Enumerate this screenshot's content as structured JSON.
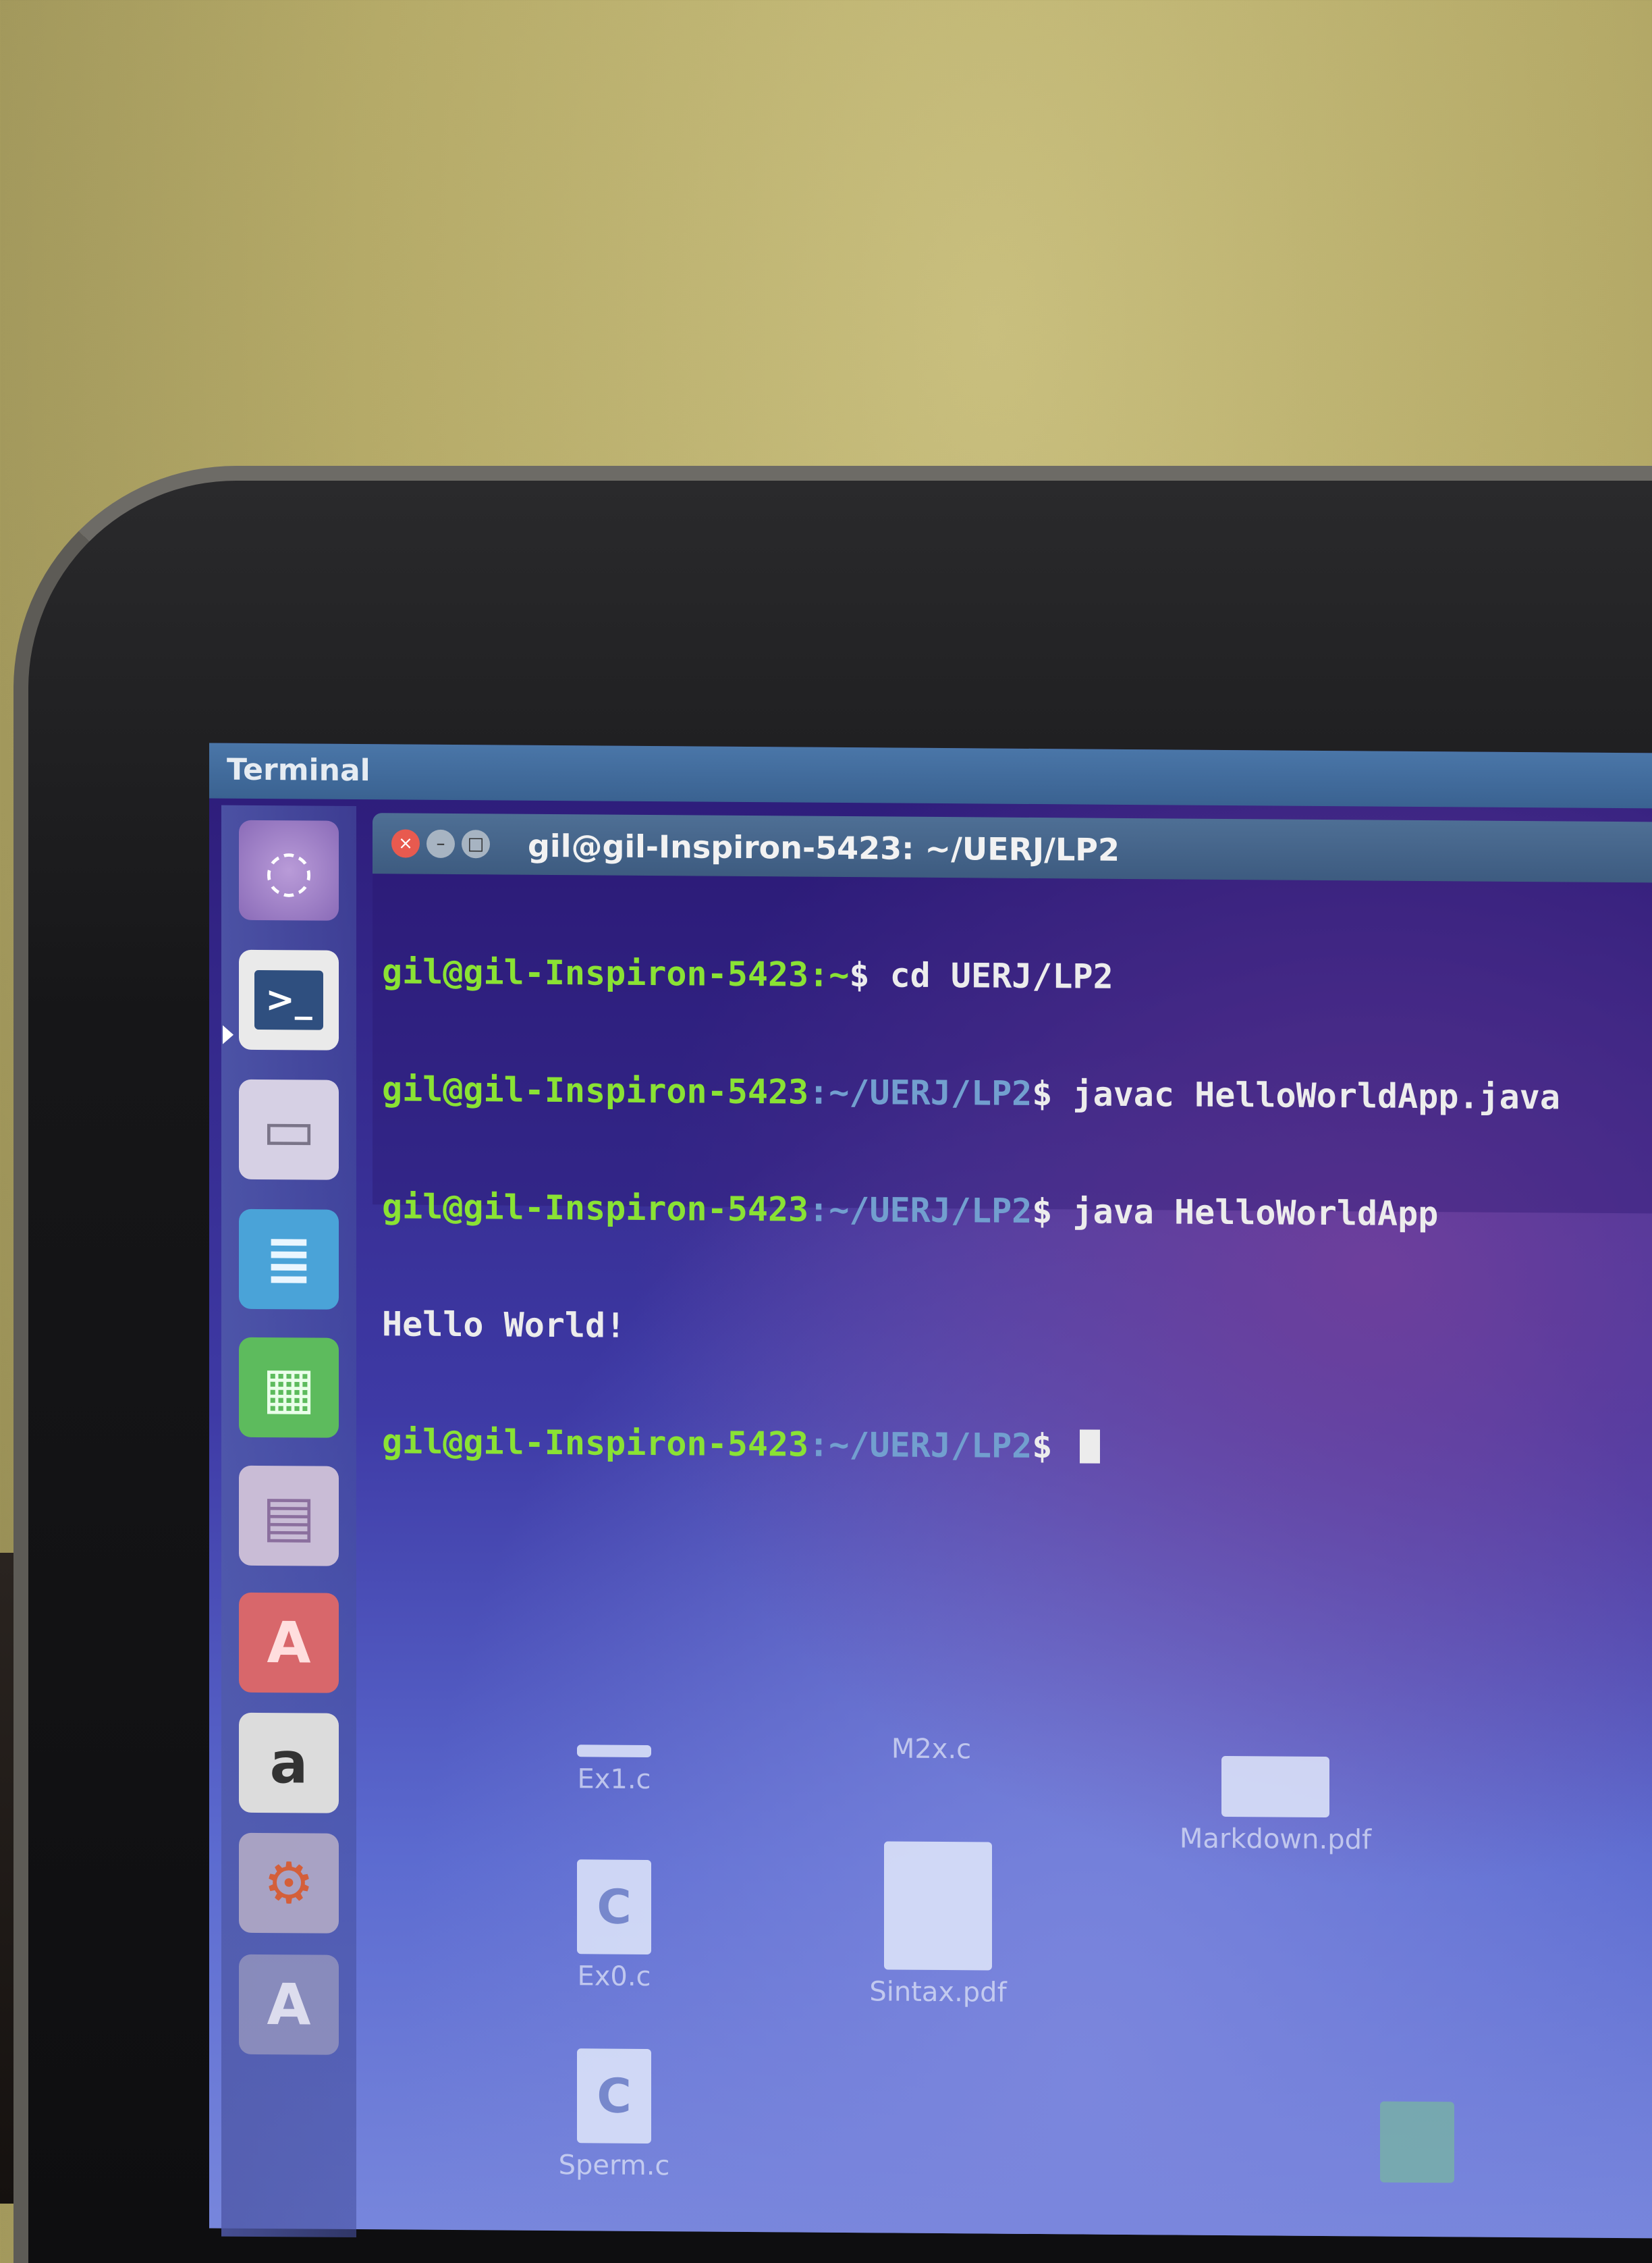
{
  "panel": {
    "title": "Terminal"
  },
  "window": {
    "title": "gil@gil-Inspiron-5423: ~/UERJ/LP2",
    "buttons": {
      "close": "×",
      "minimize": "–",
      "maximize": "□"
    }
  },
  "terminal": {
    "lines": [
      {
        "user": "gil@gil-Inspiron-5423",
        "path": ":~",
        "command": "$ cd UERJ/LP2"
      },
      {
        "user": "gil@gil-Inspiron-5423",
        "path": ":~/UERJ/LP2",
        "command": "$ javac HelloWorldApp.java"
      },
      {
        "user": "gil@gil-Inspiron-5423",
        "path": ":~/UERJ/LP2",
        "command": "$ java HelloWorldApp"
      },
      {
        "output": "Hello World!"
      },
      {
        "user": "gil@gil-Inspiron-5423",
        "path": ":~/UERJ/LP2",
        "command": "$ "
      }
    ]
  },
  "launcher": {
    "items": [
      {
        "name": "dash-icon",
        "glyph": "◌"
      },
      {
        "name": "terminal-icon",
        "glyph": ">_"
      },
      {
        "name": "files-icon",
        "glyph": "▭"
      },
      {
        "name": "writer-icon",
        "glyph": "≣"
      },
      {
        "name": "calc-icon",
        "glyph": "▦"
      },
      {
        "name": "impress-icon",
        "glyph": "▤"
      },
      {
        "name": "software-center-icon",
        "glyph": "A"
      },
      {
        "name": "amazon-icon",
        "glyph": "a"
      },
      {
        "name": "settings-icon",
        "glyph": "⚙"
      },
      {
        "name": "updater-icon",
        "glyph": "A"
      }
    ]
  },
  "desktop": {
    "icons": [
      {
        "label": "Ex1.c"
      },
      {
        "label": "M2x.c"
      },
      {
        "label": "Markdown.pdf"
      },
      {
        "label": "Ex0.c"
      },
      {
        "label": "Sintax.pdf"
      },
      {
        "label": "Sperm.c"
      }
    ]
  },
  "colors": {
    "prompt_user": "#8ae234",
    "prompt_path": "#729fcf",
    "text": "#ececec",
    "launcher_active": "#2f4f7f"
  }
}
